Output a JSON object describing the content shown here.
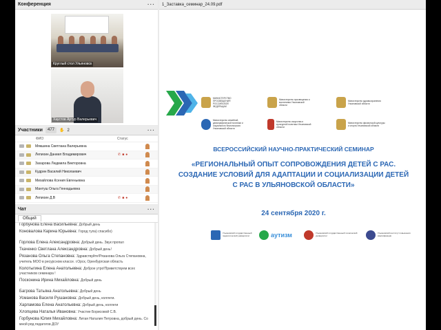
{
  "conference": {
    "title": "Конференция",
    "videos": [
      {
        "caption": "Круглый стол Ульяновск"
      },
      {
        "caption": "Хаустов Артур Валерьевич"
      }
    ]
  },
  "participants": {
    "title": "Участники",
    "count": "477",
    "raised_hands": "2",
    "col_name": "ФИО",
    "col_status": "Статус",
    "rows": [
      {
        "name": "Мякшина Светлана Валерьевна"
      },
      {
        "name": "Лепихин Даниил Владимирович"
      },
      {
        "name": "Захарова Людмила Викторовна"
      },
      {
        "name": "Кудрин Василий Николаевич"
      },
      {
        "name": "Михайлова Ксения Евгеньевна"
      },
      {
        "name": "Мантуш Ольга Геннадьевна"
      },
      {
        "name": "Лепихин Д.В"
      }
    ]
  },
  "chat": {
    "title": "Чат",
    "tab": "Общий",
    "messages": [
      {
        "author": "Горбунова Елена Васильевна:",
        "text": "Добрый день"
      },
      {
        "author": "Коновалова Карина Юрьевна:",
        "text": "Город тула) спасибо)"
      },
      {
        "author": "Горлова Елена Александровна:",
        "text": "Добрый день. Звук пропал"
      },
      {
        "author": "Ткаченко Светлана Александровна:",
        "text": "Добрый день!"
      },
      {
        "author": "Рязанова Ольга Степановна:",
        "text": "Здравствуйте!Рязанова Ольга Степановна, учитель МОО в ресурсном классе. г.Орск, Оренбургская область"
      },
      {
        "author": "Колотыгина Елена Анатольевна:",
        "text": "Доброе утро!Приветствуем всех участников семинара !"
      },
      {
        "author": "Посконина Ирина Михайловна:",
        "text": "Добрый день"
      },
      {
        "author": "Багрова Татьяна Анатольевна:",
        "text": "Добрый день"
      },
      {
        "author": "Усманова Василя Рушановна:",
        "text": "Добрый день, коллеги."
      },
      {
        "author": "Харламова Елена Анатольевна:",
        "text": "Добрый день, коллеги"
      },
      {
        "author": "Хлопцева Наталья Ивановна:",
        "text": "Участие Борисовой С.В."
      },
      {
        "author": "Горбунова Юлия Михайловна:",
        "text": "Литая Наталия Петровна, добрый день. Со мной ряд педагогов ДОУ"
      }
    ]
  },
  "document": {
    "title": "1_Заставка_семинар_24.09.pdf",
    "logos_top": [
      {
        "text": "МИНИСТЕРСТВО ПРОСВЕЩЕНИЯ РОССИЙСКОЙ ФЕДЕРАЦИИ"
      },
      {
        "text": "Министерство просвещения и воспитания Ульяновской области"
      },
      {
        "text": "Министерство здравоохранения Ульяновской области"
      }
    ],
    "logos_mid": [
      {
        "text": "Министерство семейной, демографической политики и социального благополучия Ульяновской области"
      },
      {
        "text": "Министерство искусства и культурной политики Ульяновской области"
      },
      {
        "text": "Министерство физической культуры и спорта Ульяновской области"
      }
    ],
    "heading": "ВСЕРОССИЙСКИЙ НАУЧНО-ПРАКТИЧЕСКИЙ СЕМИНАР",
    "subheading": "«РЕГИОНАЛЬНЫЙ ОПЫТ СОПРОВОЖДЕНИЯ ДЕТЕЙ С РАС. СОЗДАНИЕ УСЛОВИЙ ДЛЯ АДАПТАЦИИ И СОЦИАЛИЗАЦИИ ДЕТЕЙ С РАС В УЛЬЯНОВСКОЙ ОБЛАСТИ»",
    "date": "24 сентября 2020 г.",
    "logos_bottom": [
      {
        "text": "Ульяновский государственный педагогический университет"
      },
      {
        "text": "аутизм"
      },
      {
        "text": "Ульяновский государственный технический университет"
      },
      {
        "text": "Ульяновский институт повышения квалификации"
      }
    ]
  },
  "colors": {
    "accent": "#2b67b4",
    "green": "#27a84a"
  }
}
